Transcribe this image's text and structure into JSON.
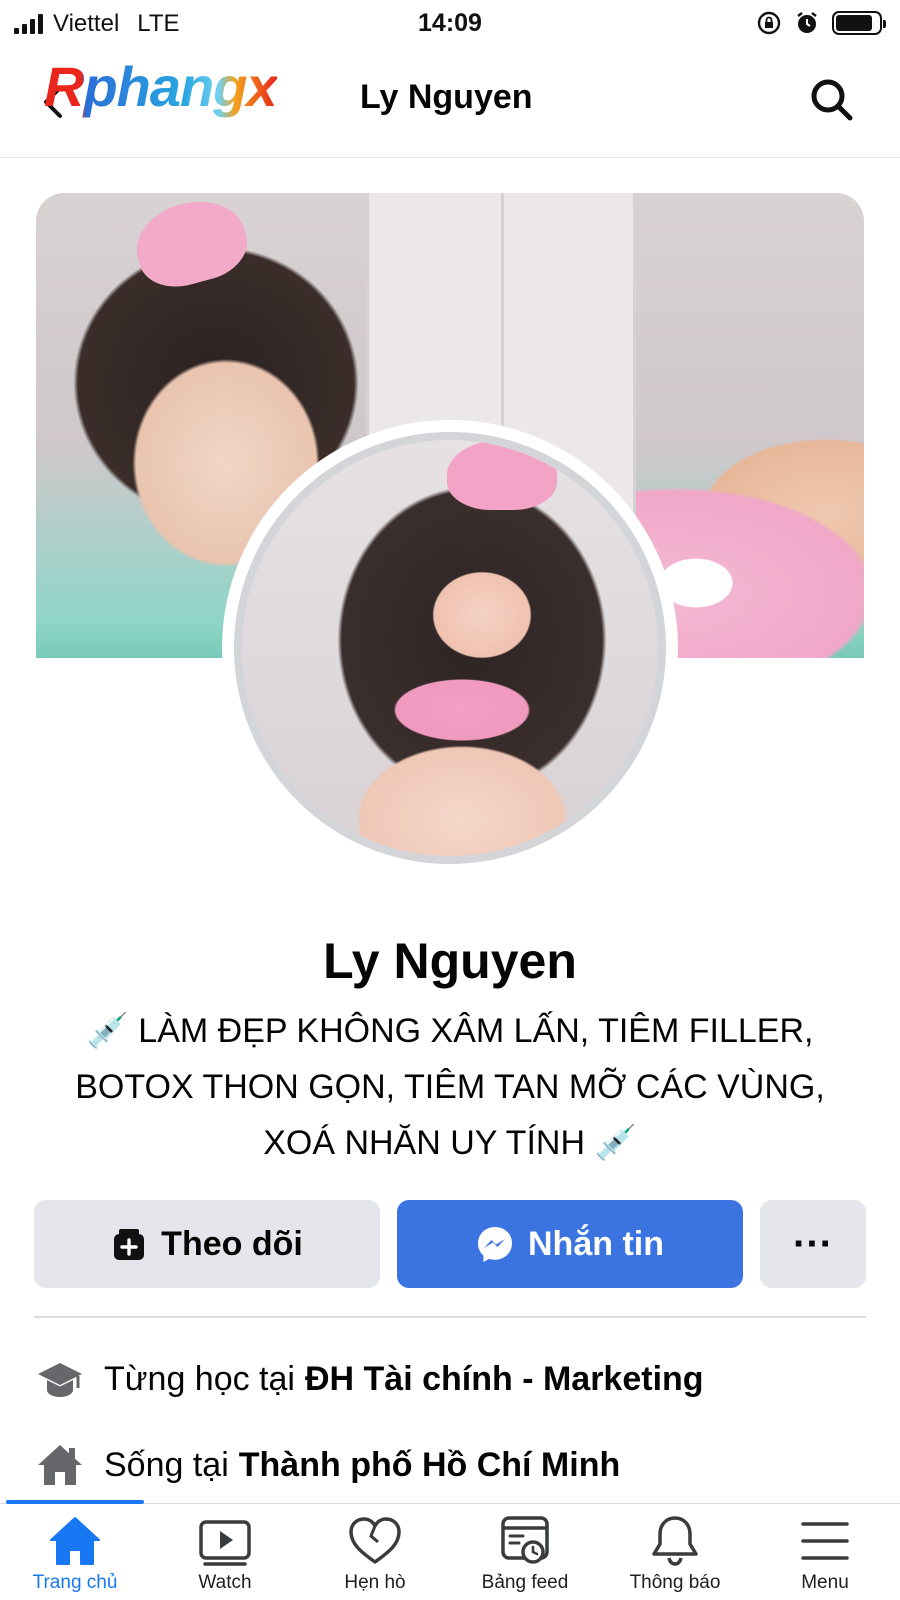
{
  "status_bar": {
    "carrier": "Viettel",
    "network": "LTE",
    "time": "14:09"
  },
  "header": {
    "logo_text": "Rphangx",
    "title": "Ly Nguyen"
  },
  "profile": {
    "name": "Ly Nguyen",
    "bio_lines": [
      "💉 LÀM ĐẸP KHÔNG XÂM LẤN, TIÊM FILLER,",
      "BOTOX THON GỌN, TIÊM TAN MỠ CÁC VÙNG,",
      "XOÁ NHĂN UY TÍNH 💉"
    ]
  },
  "actions": {
    "follow_label": "Theo dõi",
    "message_label": "Nhắn tin",
    "more_label": "···"
  },
  "details": {
    "education_prefix": "Từng học tại",
    "education_value": "ĐH Tài chính - Marketing",
    "home_prefix": "Sống tại",
    "home_value": "Thành phố Hồ Chí Minh"
  },
  "bottom_nav": {
    "items": [
      {
        "label": "Trang chủ",
        "icon": "home-icon",
        "active": true
      },
      {
        "label": "Watch",
        "icon": "watch-icon",
        "active": false
      },
      {
        "label": "Hẹn hò",
        "icon": "heart-icon",
        "active": false
      },
      {
        "label": "Bảng feed",
        "icon": "feed-icon",
        "active": false
      },
      {
        "label": "Thông báo",
        "icon": "bell-icon",
        "active": false
      },
      {
        "label": "Menu",
        "icon": "menu-icon",
        "active": false
      }
    ]
  },
  "colors": {
    "accent": "#1877f2",
    "message_button": "#3b74e0",
    "button_gray": "#e4e6eb"
  },
  "battery_level": 0.85
}
